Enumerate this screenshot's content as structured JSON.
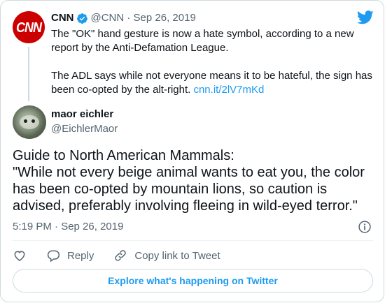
{
  "colors": {
    "link": "#1d9bf0",
    "text": "#0f1419",
    "muted": "#536471",
    "cnn_red": "#cc0000"
  },
  "quoted": {
    "avatar_label": "CNN",
    "name": "CNN",
    "handle_date": "@CNN · Sep 26, 2019",
    "line1": "The \"OK\" hand gesture is now a hate symbol, according to a new",
    "line2": "report by the Anti-Defamation League.",
    "line3": "The ADL says while not everyone means it to be hateful, the sign has",
    "line4": "been co-opted by the alt-right.",
    "link": "cnn.it/2lV7mKd"
  },
  "tweet": {
    "name": "maor eichler",
    "handle": "@EichlerMaor",
    "lines": [
      "Guide to North American Mammals:",
      "\"While not every beige animal wants to eat you, the color",
      "has been co-opted by mountain lions, so caution is",
      "advised, preferably involving fleeing in wild-eyed terror.\""
    ],
    "timestamp": "5:19 PM · Sep 26, 2019"
  },
  "actions": {
    "reply": "Reply",
    "copy": "Copy link to Tweet"
  },
  "explore_label": "Explore what's happening on Twitter",
  "icons": [
    "verified-badge-icon",
    "twitter-bird-icon",
    "info-icon",
    "heart-icon",
    "reply-icon",
    "link-icon"
  ]
}
